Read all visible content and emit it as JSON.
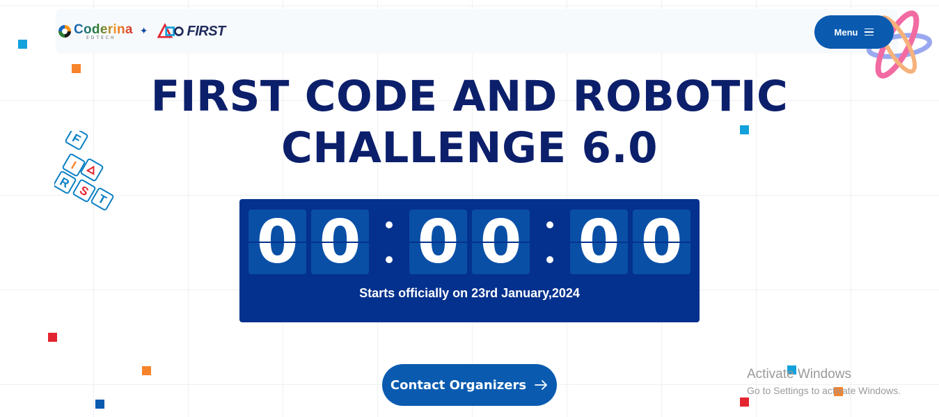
{
  "header": {
    "brand_coderina": "Coderina",
    "brand_coderina_sub": "EDTECH",
    "brand_separator": "✦",
    "brand_first": "FIRST",
    "menu_label": "Menu"
  },
  "hero": {
    "title_line1": "FIRST CODE AND ROBOTIC",
    "title_line2": "CHALLENGE 6.0"
  },
  "countdown": {
    "digits": [
      "0",
      "0",
      "0",
      "0",
      "0",
      "0"
    ],
    "start_note": "Starts officially on 23rd January,2024"
  },
  "cta": {
    "label": "Contact Organizers"
  },
  "first_tiles": {
    "letters": [
      "F",
      "I",
      "R",
      "S",
      "T"
    ]
  },
  "watermark": {
    "line1": "Activate Windows",
    "line2": "Go to Settings to activate Windows."
  },
  "colors": {
    "navy_title": "#0c1f6b",
    "countdown_bg": "#04318d",
    "digit_bg": "#0a4fa6",
    "button_blue": "#0a5bb0",
    "accent_orange": "#f7832a",
    "accent_red": "#e22530",
    "accent_cyan": "#13a1dc"
  },
  "icons": {
    "menu": "hamburger-icon",
    "cta": "arrow-right-icon",
    "orbit": "atom-orbit-icon"
  }
}
